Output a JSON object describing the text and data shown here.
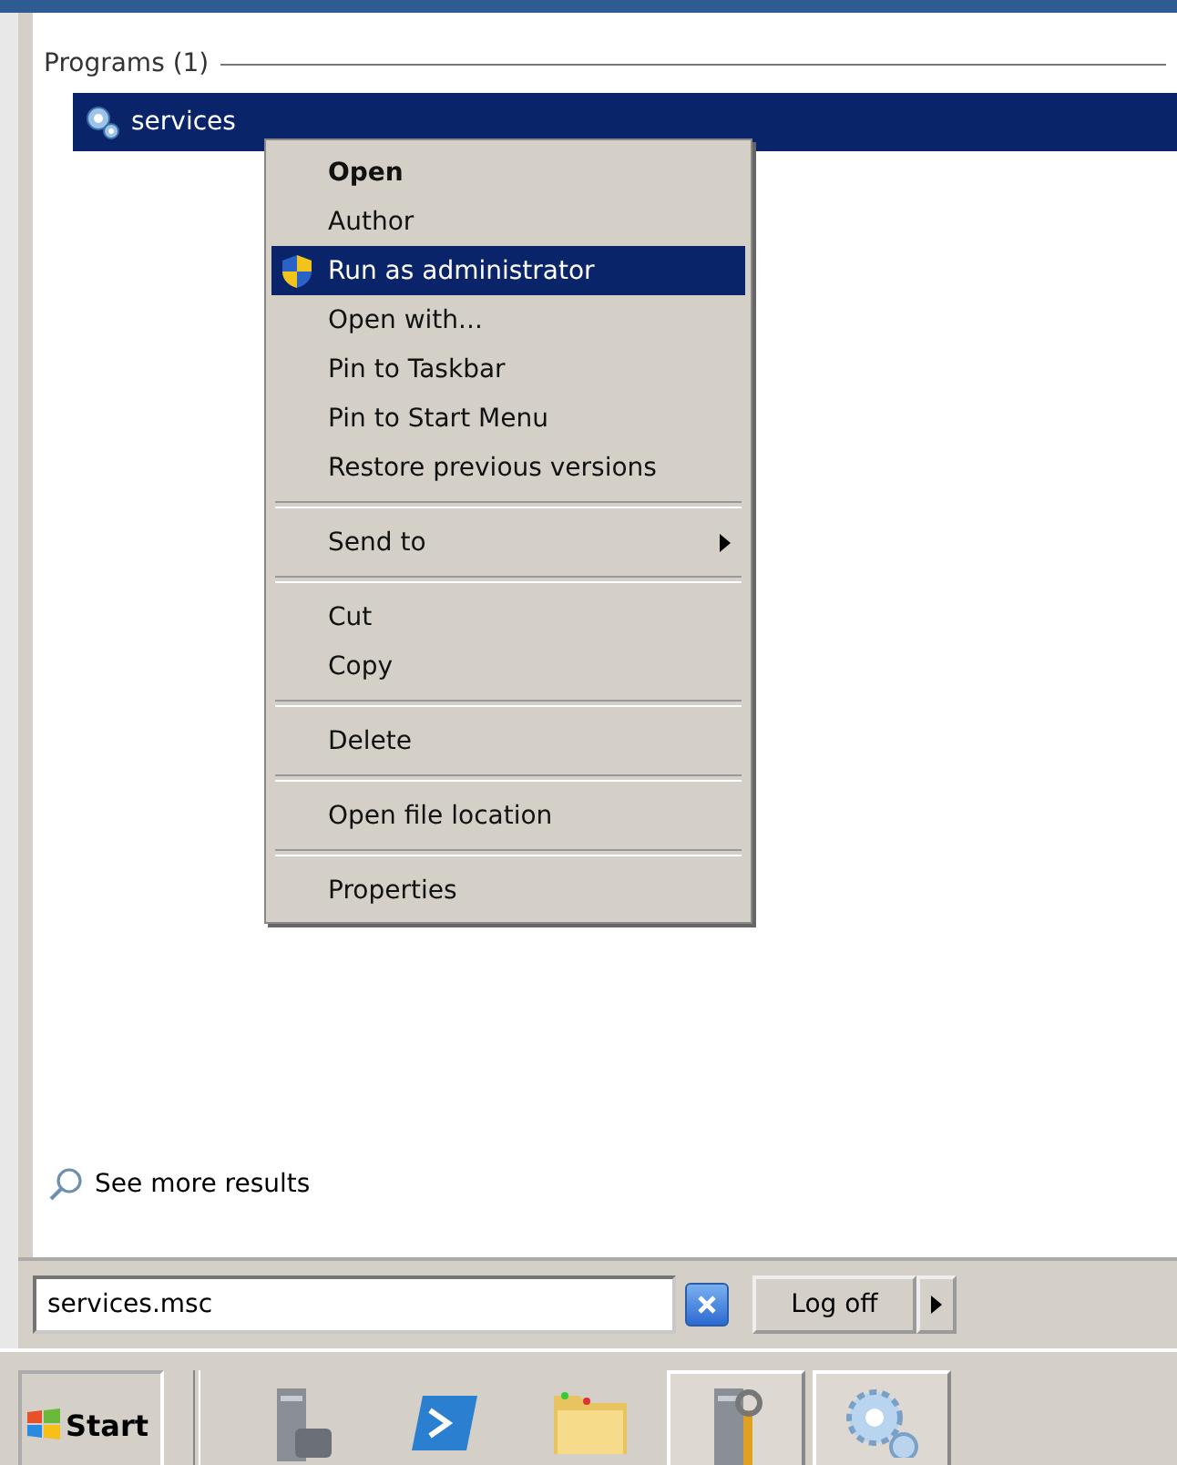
{
  "results": {
    "heading": "Programs (1)",
    "items": [
      {
        "label": "services",
        "selected": true
      }
    ]
  },
  "context_menu": {
    "items": [
      {
        "kind": "item",
        "label": "Open",
        "default": true,
        "selected": false
      },
      {
        "kind": "item",
        "label": "Author",
        "default": false,
        "selected": false
      },
      {
        "kind": "elevated",
        "label": "Run as administrator",
        "default": false,
        "selected": true
      },
      {
        "kind": "item",
        "label": "Open with...",
        "default": false,
        "selected": false
      },
      {
        "kind": "item",
        "label": "Pin to Taskbar",
        "default": false,
        "selected": false
      },
      {
        "kind": "item",
        "label": "Pin to Start Menu",
        "default": false,
        "selected": false
      },
      {
        "kind": "item",
        "label": "Restore previous versions",
        "default": false,
        "selected": false
      },
      {
        "kind": "separator"
      },
      {
        "kind": "item",
        "label": "Send to",
        "default": false,
        "selected": false,
        "submenu": true
      },
      {
        "kind": "separator"
      },
      {
        "kind": "item",
        "label": "Cut",
        "default": false,
        "selected": false
      },
      {
        "kind": "item",
        "label": "Copy",
        "default": false,
        "selected": false
      },
      {
        "kind": "separator"
      },
      {
        "kind": "item",
        "label": "Delete",
        "default": false,
        "selected": false
      },
      {
        "kind": "separator"
      },
      {
        "kind": "item",
        "label": "Open file location",
        "default": false,
        "selected": false
      },
      {
        "kind": "separator"
      },
      {
        "kind": "item",
        "label": "Properties",
        "default": false,
        "selected": false
      }
    ]
  },
  "see_more": "See more results",
  "search": {
    "value": "services.msc"
  },
  "log_off": "Log off",
  "taskbar": {
    "start": "Start",
    "buttons": [
      {
        "kind": "server",
        "running": false
      },
      {
        "kind": "shell",
        "running": false
      },
      {
        "kind": "folder",
        "running": false
      },
      {
        "kind": "tools",
        "running": true
      },
      {
        "kind": "gears",
        "running": true
      }
    ]
  }
}
